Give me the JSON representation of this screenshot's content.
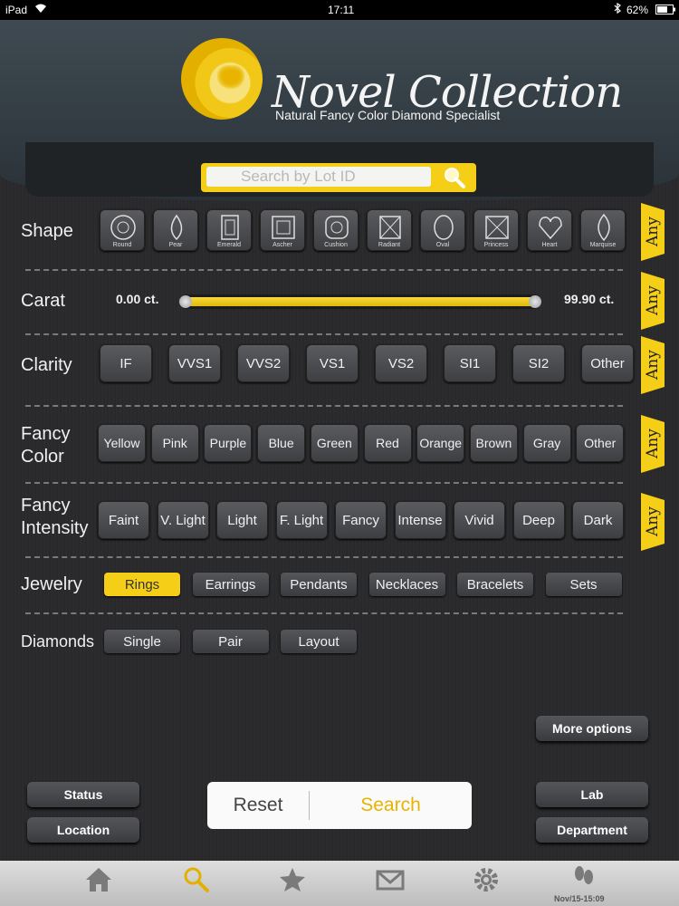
{
  "statusbar": {
    "device": "iPad",
    "time": "17:11",
    "battery": "62%"
  },
  "header": {
    "brand": "Novel Collection",
    "tagline": "Natural Fancy Color Diamond Specialist"
  },
  "search": {
    "placeholder": "Search by Lot ID"
  },
  "any_label": "Any",
  "shape": {
    "label": "Shape",
    "items": [
      "Round",
      "Pear",
      "Emerald",
      "Ascher",
      "Cushion",
      "Radiant",
      "Oval",
      "Princess",
      "Heart",
      "Marquise"
    ]
  },
  "carat": {
    "label": "Carat",
    "min_value": "0.00 ct.",
    "max_value": "99.90 ct.",
    "min_fraction": 0.0,
    "max_fraction": 1.0
  },
  "clarity": {
    "label": "Clarity",
    "items": [
      "IF",
      "VVS1",
      "VVS2",
      "VS1",
      "VS2",
      "SI1",
      "SI2",
      "Other"
    ]
  },
  "fancy_color": {
    "label_line1": "Fancy",
    "label_line2": "Color",
    "items": [
      "Yellow",
      "Pink",
      "Purple",
      "Blue",
      "Green",
      "Red",
      "Orange",
      "Brown",
      "Gray",
      "Other"
    ]
  },
  "fancy_intensity": {
    "label_line1": "Fancy",
    "label_line2": "Intensity",
    "items": [
      "Faint",
      "V. Light",
      "Light",
      "F. Light",
      "Fancy",
      "Intense",
      "Vivid",
      "Deep",
      "Dark"
    ]
  },
  "jewelry": {
    "label": "Jewelry",
    "items": [
      "Rings",
      "Earrings",
      "Pendants",
      "Necklaces",
      "Bracelets",
      "Sets"
    ],
    "selected": "Rings"
  },
  "diamonds": {
    "label": "Diamonds",
    "items": [
      "Single",
      "Pair",
      "Layout"
    ]
  },
  "buttons": {
    "more_options": "More options",
    "status": "Status",
    "location": "Location",
    "lab": "Lab",
    "department": "Department",
    "reset": "Reset",
    "search": "Search"
  },
  "tabbar": {
    "items": [
      "home-icon",
      "search-icon",
      "star-icon",
      "mail-icon",
      "gear-icon",
      "footprints-icon"
    ],
    "footer_text": "Nov/15-15:09"
  },
  "colors": {
    "accent": "#f5cf17",
    "background": "#2a2a2c"
  }
}
